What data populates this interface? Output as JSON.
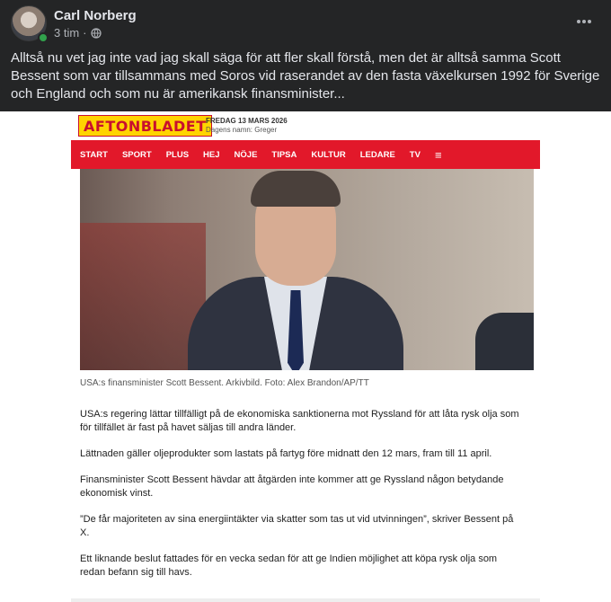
{
  "post": {
    "author": "Carl Norberg",
    "time": "3 tim",
    "separator": "·",
    "more_icon": "more-horizontal-icon",
    "privacy_icon": "globe-icon",
    "text": "Alltså nu vet jag inte vad jag skall säga för att fler skall förstå, men det är alltså samma Scott Bessent som var tillsammans med Soros vid raserandet av den fasta växelkursen 1992 för Sverige och England och som nu är amerikansk finansminister..."
  },
  "article": {
    "logo": "AFTONBLADET",
    "date": "FREDAG 13 MARS 2026",
    "name_day": "Dagens namn: Greger",
    "nav": [
      "START",
      "SPORT",
      "PLUS",
      "HEJ",
      "NÖJE",
      "TIPSA",
      "KULTUR",
      "LEDARE",
      "TV"
    ],
    "menu_icon": "hamburger-menu-icon",
    "caption": "USA:s finansminister Scott Bessent. Arkivbild. Foto: Alex Brandon/AP/TT",
    "paragraphs": [
      "USA:s regering lättar tillfälligt på de ekonomiska sanktionerna mot Ryssland för att låta rysk olja som för tillfället är fast på havet säljas till andra länder.",
      "Lättnaden gäller oljeprodukter som lastats på fartyg före midnatt den 12 mars, fram till 11 april.",
      "Finansminister Scott Bessent hävdar att åtgärden inte kommer att ge Ryssland någon betydande ekonomisk vinst.",
      "”De får majoriteten av sina energiintäkter via skatter som tas ut vid utvinningen”, skriver Bessent på X.",
      "Ett liknande beslut fattades för en vecka sedan för att ge Indien möjlighet att köpa rysk olja som redan befann sig till havs."
    ]
  },
  "colors": {
    "background": "#242526",
    "text_primary": "#e4e6eb",
    "text_secondary": "#b0b3b8",
    "online": "#31a24c",
    "aftonbladet_red": "#e2182a",
    "aftonbladet_yellow": "#ffd400"
  }
}
